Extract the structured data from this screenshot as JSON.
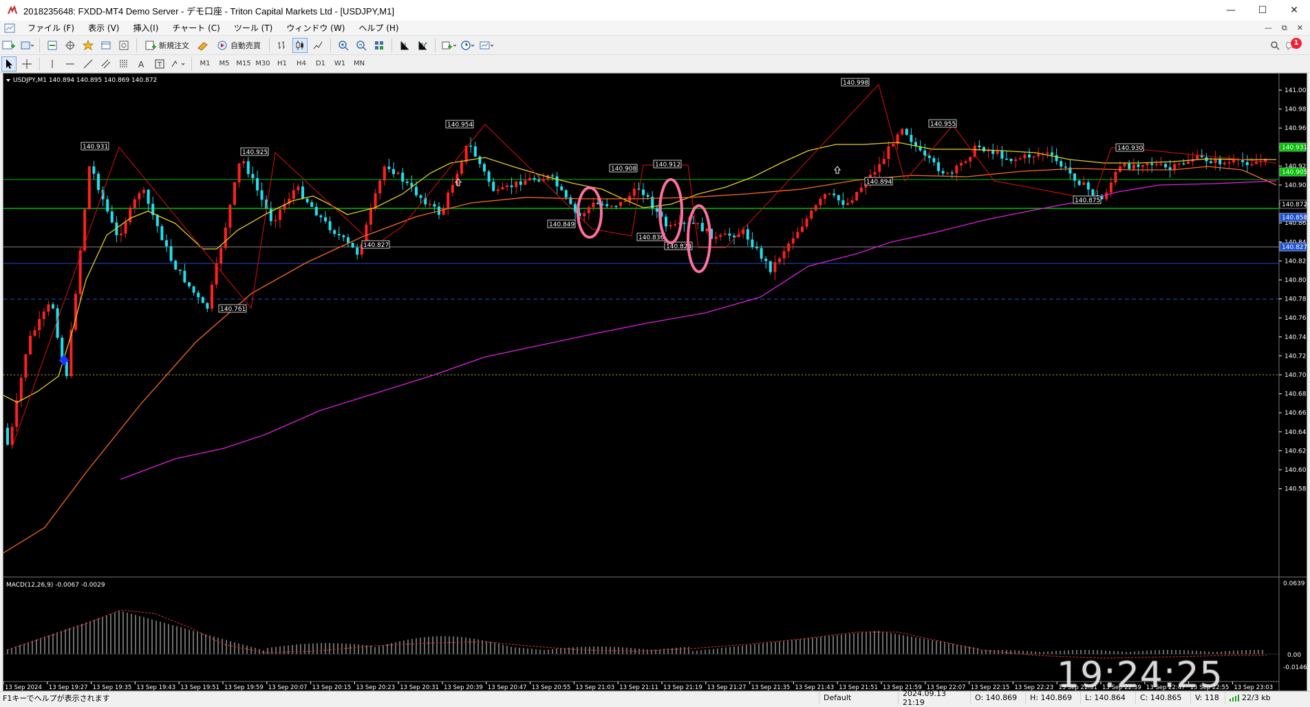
{
  "window": {
    "title": "2018235648: FXDD-MT4 Demo Server - デモ口座 - Triton Capital Markets Ltd - [USDJPY,M1]"
  },
  "menu": {
    "items": [
      "ファイル (F)",
      "表示 (V)",
      "挿入(I)",
      "チャート (C)",
      "ツール (T)",
      "ウィンドウ (W)",
      "ヘルプ (H)"
    ]
  },
  "toolbar": {
    "new_order_label": "新規注文",
    "auto_trade_label": "自動売買",
    "notification_count": "1"
  },
  "timeframes": [
    "M1",
    "M5",
    "M15",
    "M30",
    "H1",
    "H4",
    "D1",
    "W1",
    "MN"
  ],
  "chart": {
    "header": "USDJPY,M1  140.894 140.895 140.869 140.872",
    "macd_header": "MACD(12,26,9) -0.0067 -0.0029",
    "macd_axis": [
      "0.0639",
      "0.00",
      "-0.0146"
    ],
    "price_axis": [
      "141.005",
      "140.985",
      "140.965",
      "140.945",
      "140.925",
      "140.905",
      "140.885",
      "140.865",
      "140.845",
      "140.825",
      "140.805",
      "140.785",
      "140.765",
      "140.745",
      "140.725",
      "140.705",
      "140.685",
      "140.665",
      "140.645",
      "140.625",
      "140.605",
      "140.585"
    ],
    "price_axis_tags": [
      {
        "text": "140.931",
        "color": "#00c000"
      },
      {
        "text": "140.905",
        "color": "#00c000"
      },
      {
        "text": "140.872",
        "color": "#000000"
      },
      {
        "text": "140.858",
        "color": "#1e4fd0"
      },
      {
        "text": "140.827",
        "color": "#1e4fd0"
      }
    ],
    "time_axis": [
      "13 Sep 2024",
      "13 Sep 19:27",
      "13 Sep 19:35",
      "13 Sep 19:43",
      "13 Sep 19:51",
      "13 Sep 19:59",
      "13 Sep 20:07",
      "13 Sep 20:15",
      "13 Sep 20:23",
      "13 Sep 20:31",
      "13 Sep 20:39",
      "13 Sep 20:47",
      "13 Sep 20:55",
      "13 Sep 21:03",
      "13 Sep 21:11",
      "13 Sep 21:19",
      "13 Sep 21:27",
      "13 Sep 21:35",
      "13 Sep 21:43",
      "13 Sep 21:51",
      "13 Sep 21:59",
      "13 Sep 22:07",
      "13 Sep 22:15",
      "13 Sep 22:23",
      "13 Sep 22:31",
      "13 Sep 22:39",
      "13 Sep 22:47",
      "13 Sep 22:55",
      "13 Sep 23:03"
    ],
    "swing_labels": [
      "140.931",
      "140.925",
      "140.761",
      "140.827",
      "140.954",
      "140.849",
      "140.908",
      "140.912",
      "140.836",
      "140.824",
      "140.998",
      "140.955",
      "140.894",
      "140.930",
      "140.875"
    ],
    "colors": {
      "bull": "#ff2020",
      "bear": "#20e0f0",
      "ma_fast": "#e8d020",
      "ma_mid": "#ff6a20",
      "ma_slow": "#e020e0",
      "zigzag": "#e01010",
      "hline_green": "#00c000",
      "hline_blue": "#1e4fd0",
      "hline_yellow": "#c8c000",
      "highlight": "#ff6fa0"
    }
  },
  "clock": "19:24:25",
  "status": {
    "help": "F1キーでヘルプが表示されます",
    "profile": "Default",
    "datetime": "2024.09.13 21:19",
    "open": "O: 140.869",
    "high": "H: 140.869",
    "low": "L: 140.864",
    "close": "C: 140.865",
    "volume": "V: 118",
    "traffic": "22/3 kb"
  }
}
